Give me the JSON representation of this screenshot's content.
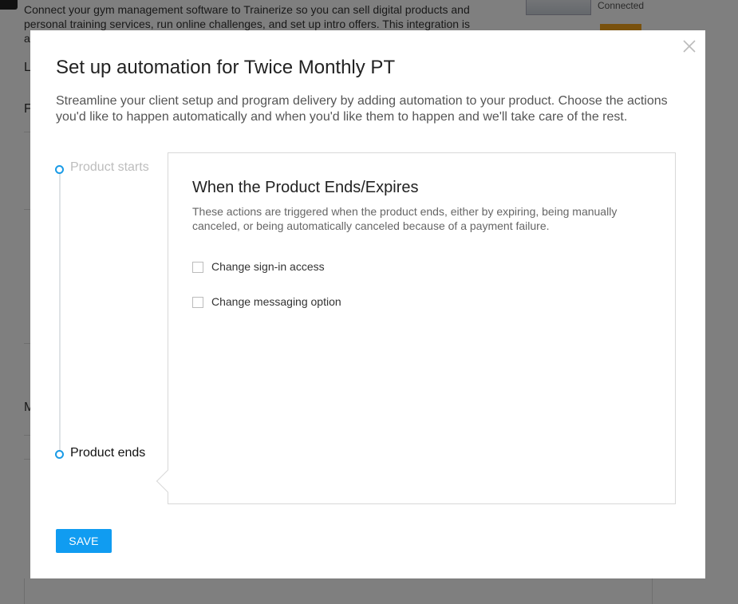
{
  "background": {
    "description": "Connect your gym management software to Trainerize so you can sell digital products and personal training services, run online challenges, and set up intro offers. This integration is a",
    "status": "Connected",
    "fragments": [
      "L",
      "F",
      "M"
    ]
  },
  "modal": {
    "title": "Set up automation for Twice Monthly PT",
    "description": "Streamline your client setup and program delivery by adding automation to your product. Choose the actions you'd like to happen automatically and when you'd like them to happen and we'll take care of the rest.",
    "close_icon": "close-icon",
    "timeline": {
      "steps": [
        {
          "label": "Product starts",
          "active": false
        },
        {
          "label": "Product ends",
          "active": true
        }
      ]
    },
    "panel": {
      "title": "When the Product Ends/Expires",
      "description": "These actions are triggered when the product ends, either by expiring, being manually canceled, or being automatically canceled because of a payment failure.",
      "options": [
        {
          "label": "Change sign-in access",
          "checked": false
        },
        {
          "label": "Change messaging option",
          "checked": false
        }
      ]
    },
    "save_label": "SAVE"
  },
  "colors": {
    "accent": "#109cf1",
    "overlay": "rgba(0,0,0,0.5)",
    "timeline_dot": "#1a9be6",
    "inactive_step": "#bdbdbd"
  }
}
